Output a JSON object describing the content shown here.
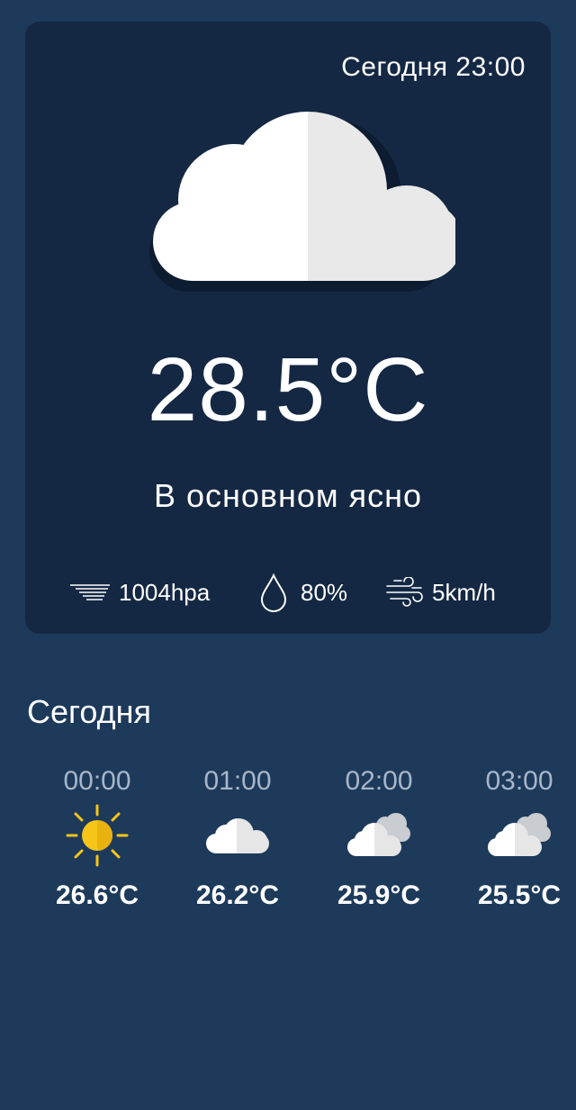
{
  "current": {
    "datetime": "Сегодня 23:00",
    "icon": "cloud-icon",
    "temperature": "28.5°C",
    "condition": "В основном ясно",
    "pressure": "1004hpa",
    "humidity": "80%",
    "wind": "5km/h"
  },
  "today": {
    "title": "Сегодня",
    "hours": [
      {
        "time": "00:00",
        "icon": "sun-icon",
        "temp": "26.6°C"
      },
      {
        "time": "01:00",
        "icon": "cloud-icon",
        "temp": "26.2°C"
      },
      {
        "time": "02:00",
        "icon": "cloudy-icon",
        "temp": "25.9°C"
      },
      {
        "time": "03:00",
        "icon": "cloudy-icon",
        "temp": "25.5°C"
      }
    ]
  },
  "colors": {
    "background": "#1d3a5b",
    "card": "#142844",
    "sun": "#f5c518"
  }
}
